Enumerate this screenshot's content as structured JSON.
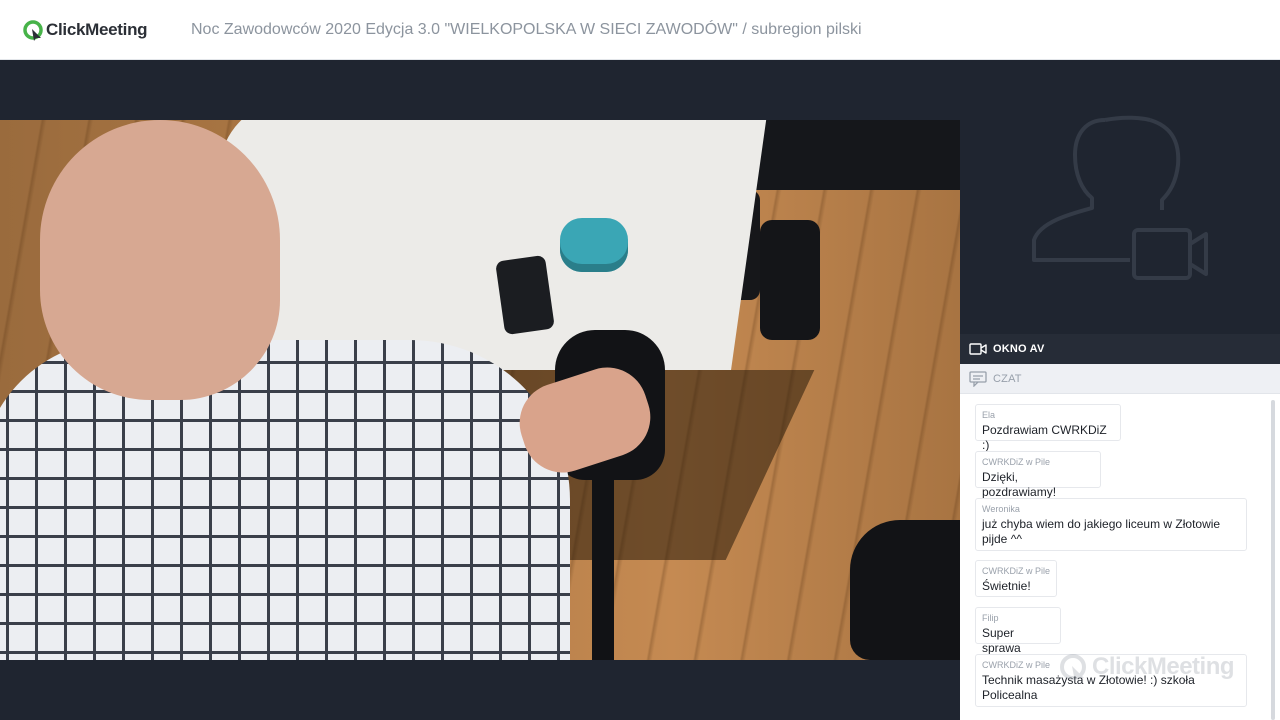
{
  "app": {
    "brand": "ClickMeeting",
    "event_title": "Noc Zawodowców 2020 Edycja 3.0 \"WIELKOPOLSKA W SIECI ZAWODÓW\" / subregion pilski"
  },
  "colors": {
    "brand_green": "#47b349",
    "dark_bg": "#1f2530",
    "panel_tab": "#262c37"
  },
  "panel": {
    "av_tab_label": "OKNO AV",
    "av_tab_icon": "video-camera-icon",
    "chat_tab_label": "CZAT",
    "chat_tab_icon": "chat-icon",
    "av_placeholder_icon": "user-camera-placeholder-icon"
  },
  "chat": {
    "messages": [
      {
        "author": "Ela",
        "text": "Pozdrawiam CWRKDiZ :)"
      },
      {
        "author": "CWRKDiZ w Pile",
        "text": "Dzięki, pozdrawiamy!"
      },
      {
        "author": "Weronika",
        "text_line1": "już chyba wiem do jakiego liceum w Złotowie",
        "text_line2": "pijde ^^"
      },
      {
        "author": "CWRKDiZ w Pile",
        "text": "Świetnie!"
      },
      {
        "author": "Filip",
        "text": "Super sprawa"
      },
      {
        "author": "CWRKDiZ w Pile",
        "text_line1": "Technik masażysta w Złotowie! :) szkoła",
        "text_line2": "Policealna"
      }
    ]
  },
  "watermark": {
    "text": "ClickMeeting"
  }
}
